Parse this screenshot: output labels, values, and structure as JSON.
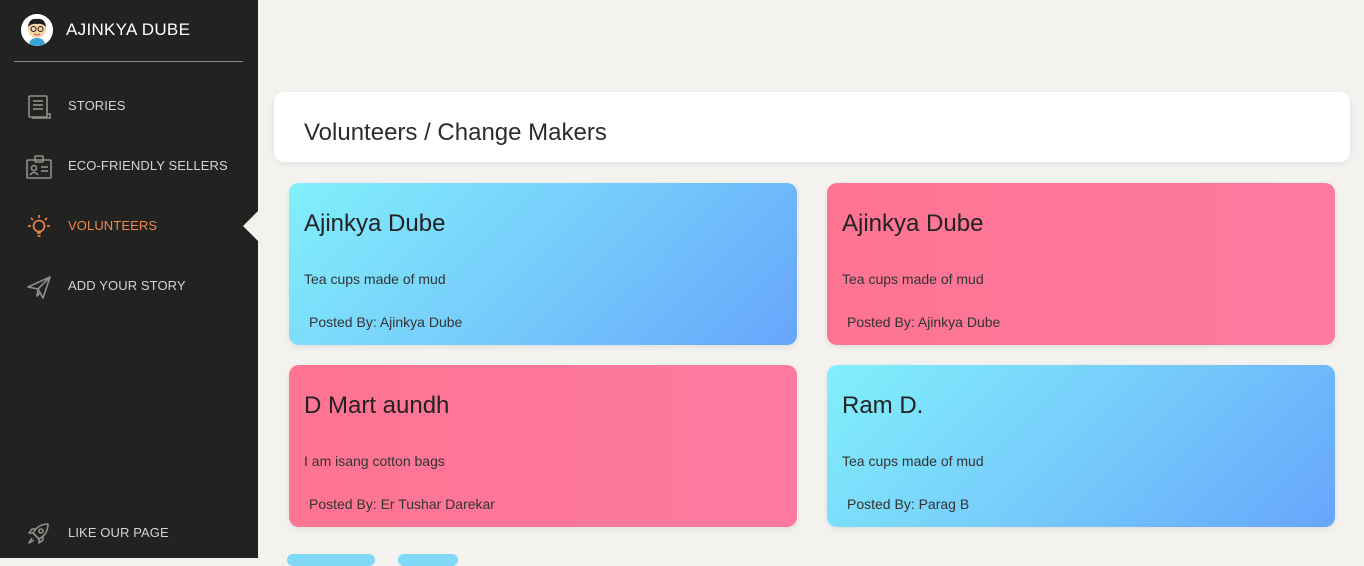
{
  "sidebar": {
    "profile_name": "AJINKYA DUBE",
    "items": [
      {
        "label": "STORIES",
        "icon": "document-icon"
      },
      {
        "label": "ECO-FRIENDLY SELLERS",
        "icon": "id-card-icon"
      },
      {
        "label": "VOLUNTEERS",
        "icon": "lightbulb-icon",
        "active": true
      },
      {
        "label": "ADD YOUR STORY",
        "icon": "paper-plane-icon"
      }
    ],
    "footer_item": {
      "label": "LIKE OUR PAGE",
      "icon": "rocket-icon"
    }
  },
  "main": {
    "title": "Volunteers / Change Makers",
    "cards": [
      {
        "title": "Ajinkya Dube",
        "description": "Tea cups made of mud",
        "posted": "Posted By: Ajinkya Dube"
      },
      {
        "title": "Ajinkya Dube",
        "description": "Tea cups made of mud",
        "posted": "Posted By: Ajinkya Dube"
      },
      {
        "title": "D Mart aundh",
        "description": "I am isang cotton bags",
        "posted": "Posted By: Er Tushar Darekar"
      },
      {
        "title": "Ram D.",
        "description": "Tea cups made of mud",
        "posted": "Posted By: Parag B"
      }
    ]
  },
  "colors": {
    "sidebar_bg": "#222220",
    "accent": "#f08a4b",
    "card_blue": "#78cffb",
    "card_pink": "#fe7491"
  }
}
